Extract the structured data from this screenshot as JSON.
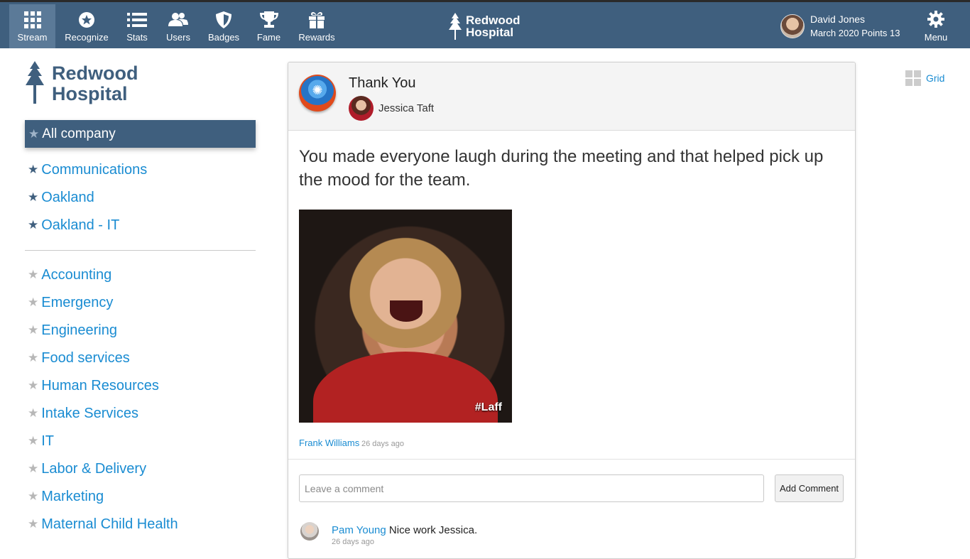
{
  "nav": [
    {
      "label": "Stream",
      "icon": "grid-icon",
      "active": true
    },
    {
      "label": "Recognize",
      "icon": "star-circle-icon"
    },
    {
      "label": "Stats",
      "icon": "list-icon"
    },
    {
      "label": "Users",
      "icon": "users-icon"
    },
    {
      "label": "Badges",
      "icon": "shield-icon"
    },
    {
      "label": "Fame",
      "icon": "trophy-icon"
    },
    {
      "label": "Rewards",
      "icon": "gift-icon"
    }
  ],
  "brand": {
    "line1": "Redwood",
    "line2": "Hospital"
  },
  "user": {
    "name": "David Jones",
    "points": "March 2020 Points 13"
  },
  "menu": {
    "label": "Menu"
  },
  "sidebar": {
    "active": "All company",
    "favorites": [
      "Communications",
      "Oakland",
      "Oakland - IT"
    ],
    "groups": [
      "Accounting",
      "Emergency",
      "Engineering",
      "Food services",
      "Human Resources",
      "Intake Services",
      "IT",
      "Labor & Delivery",
      "Marketing",
      "Maternal Child Health"
    ]
  },
  "view_toggle": {
    "label": "Grid"
  },
  "post": {
    "title": "Thank You",
    "recipient": "Jessica Taft",
    "message": "You made everyone laugh during the meeting and that helped pick up the mood for the team.",
    "gif_tag": "#Laff",
    "giver": "Frank Williams",
    "time": "26 days ago",
    "comment_placeholder": "Leave a comment",
    "add_comment_label": "Add Comment",
    "comments": [
      {
        "author": "Pam Young",
        "text": " Nice work Jessica.",
        "time": "26 days ago"
      }
    ]
  },
  "colors": {
    "header": "#3f5f7e",
    "active_nav": "#5b7a98",
    "link": "#1a8cd2"
  }
}
